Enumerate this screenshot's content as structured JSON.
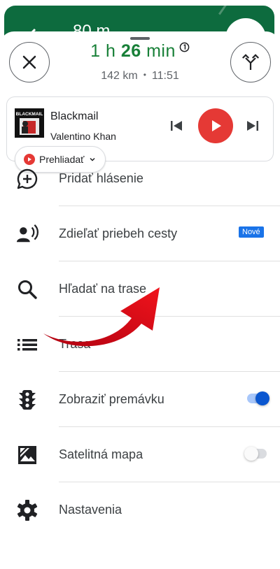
{
  "banner": {
    "distance": "80 m"
  },
  "eta": {
    "hours": "1 h",
    "minutes": "26",
    "unit": "min",
    "distance": "142 km",
    "separator": "•",
    "arrival": "11:51"
  },
  "media": {
    "track": "Blackmail",
    "artist": "Valentino Khan",
    "browse_label": "Prehliadať",
    "album_art_text": "BLACKMAIL"
  },
  "menu": {
    "items": [
      {
        "label": "Pridať hlásenie",
        "icon": "add-comment-icon"
      },
      {
        "label": "Zdieľať priebeh cesty",
        "icon": "share-location-person-icon",
        "badge": "Nové"
      },
      {
        "label": "Hľadať na trase",
        "icon": "search-icon"
      },
      {
        "label": "Trasa",
        "icon": "list-icon"
      },
      {
        "label": "Zobraziť premávku",
        "icon": "traffic-light-icon",
        "toggle": true
      },
      {
        "label": "Satelitná mapa",
        "icon": "satellite-image-icon",
        "toggle": false
      },
      {
        "label": "Nastavenia",
        "icon": "gear-icon"
      }
    ]
  },
  "colors": {
    "eta_green": "#188038",
    "banner_green": "#0d6b3e",
    "play_red": "#e53935",
    "badge_blue": "#1a73e8",
    "toggle_blue": "#0b57d0",
    "annotation_red": "#e0131a"
  }
}
